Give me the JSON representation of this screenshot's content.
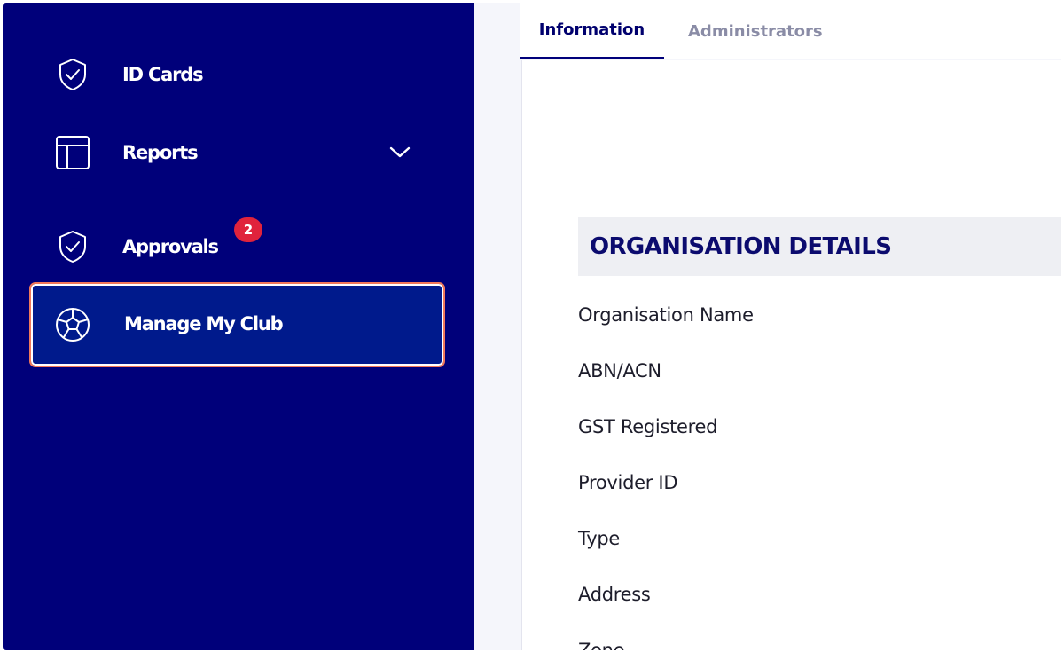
{
  "sidebar": {
    "items": [
      {
        "label": "ID Cards",
        "icon": "shield-check-icon"
      },
      {
        "label": "Reports",
        "icon": "layout-icon",
        "has_chevron": true
      },
      {
        "label": "Approvals",
        "icon": "shield-check-icon",
        "badge": "2"
      },
      {
        "label": "Manage My Club",
        "icon": "soccer-ball-icon",
        "active": true
      }
    ]
  },
  "tabs": [
    {
      "label": "Information",
      "active": true
    },
    {
      "label": "Administrators",
      "active": false
    }
  ],
  "section": {
    "title": "ORGANISATION DETAILS",
    "fields": [
      "Organisation Name",
      "ABN/ACN",
      "GST Registered",
      "Provider ID",
      "Type",
      "Address",
      "Zone"
    ]
  },
  "colors": {
    "sidebar_bg": "#00007a",
    "active_bg": "#001a8c",
    "highlight_border": "#f0785a",
    "badge": "#e0233c",
    "heading": "#0b0b6e"
  }
}
